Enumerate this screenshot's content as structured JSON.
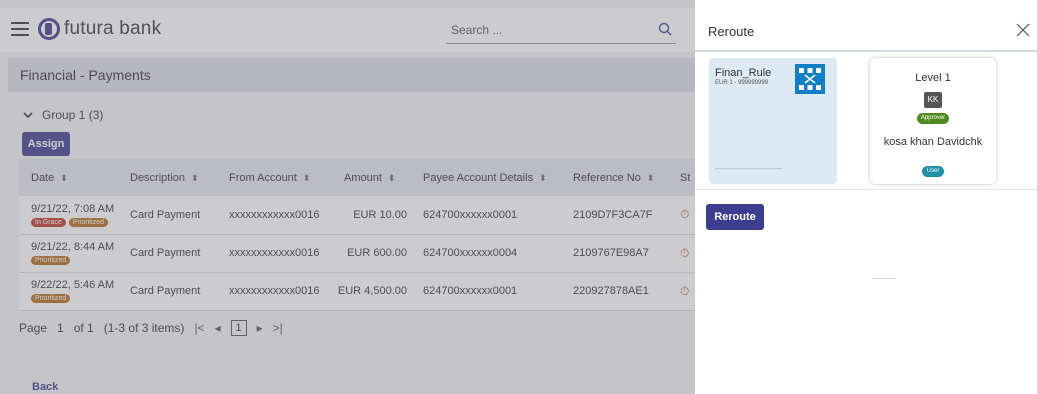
{
  "app": {
    "brand": "futura bank",
    "search_placeholder": "Search ...",
    "page_title": "Financial - Payments",
    "group_label": "Group 1 (3)",
    "assign_label": "Assign",
    "columns": [
      "Date",
      "Description",
      "From Account",
      "Amount",
      "Payee Account Details",
      "Reference No",
      "St"
    ],
    "rows": [
      {
        "date": "9/21/22, 7:08 AM",
        "badges": [
          "In Grace",
          "Prioritized"
        ],
        "description": "Card Payment",
        "from_account": "xxxxxxxxxxxx0016",
        "amount": "EUR 10.00",
        "payee": "624700xxxxxx0001",
        "reference": "2109D7F3CA7F"
      },
      {
        "date": "9/21/22, 8:44 AM",
        "badges": [
          "Prioritized"
        ],
        "description": "Card Payment",
        "from_account": "xxxxxxxxxxxx0016",
        "amount": "EUR 600.00",
        "payee": "624700xxxxxx0004",
        "reference": "2109767E98A7"
      },
      {
        "date": "9/22/22, 5:46 AM",
        "badges": [
          "Prioritized"
        ],
        "description": "Card Payment",
        "from_account": "xxxxxxxxxxxx0016",
        "amount": "EUR 4,500.00",
        "payee": "624700xxxxxx0001",
        "reference": "220927878AE1"
      }
    ],
    "pager": {
      "page_label": "Page",
      "current": "1",
      "of_label": "of 1",
      "items_label": "(1-3 of 3 items)",
      "page_box": "1"
    },
    "back_label": "Back"
  },
  "panel": {
    "title": "Reroute",
    "rule_name": "Finan_Rule",
    "rule_sub": "EUR 1 - 999999999",
    "level_title": "Level 1",
    "avatar_initials": "KK",
    "approver_label": "Approver",
    "user_name": "kosa khan Davidchk",
    "user_badge": "User",
    "reroute_label": "Reroute"
  },
  "colors": {
    "primary": "#3d3d8f",
    "badge_in_grace": "#c0392b",
    "badge_prioritized": "#b36b1c",
    "approver": "#4f8a1e",
    "user": "#1f8fa8",
    "rule_card": "#dde9f3"
  }
}
